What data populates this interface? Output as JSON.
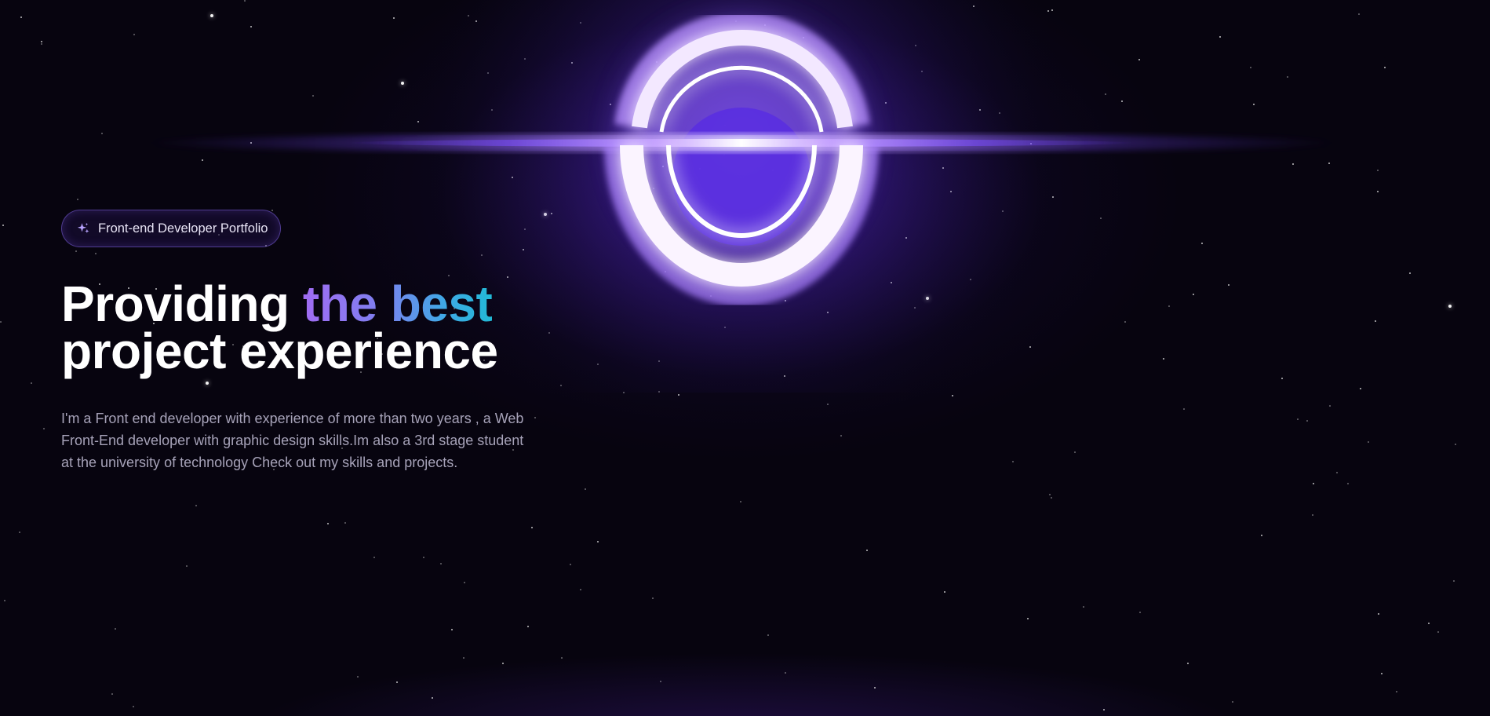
{
  "hero": {
    "badge_label": "Front-end Developer Portfolio",
    "badge_icon": "sparkles-icon",
    "title_part1": "Providing ",
    "title_highlight": "the best",
    "title_part2": "project experience",
    "description": "I'm a Front end developer with experience of more than two years , a Web Front-End developer with graphic design skills.Im also a 3rd stage student at the university of technology Check out my skills and projects."
  },
  "colors": {
    "background": "#07040f",
    "accent_purple": "#8b5cf6",
    "gradient_start": "#a06cf2",
    "gradient_end": "#22b9d6",
    "text_primary": "#ffffff",
    "text_secondary": "#a6a2b8"
  }
}
